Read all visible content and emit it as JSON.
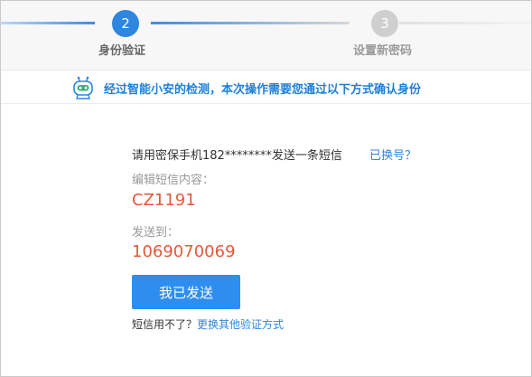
{
  "steps": {
    "active": {
      "number": "2",
      "label": "身份验证"
    },
    "next": {
      "number": "3",
      "label": "设置新密码"
    }
  },
  "notice": {
    "icon": "robot-assistant-icon",
    "text": "经过智能小安的检测，本次操作需要您通过以下方式确认身份"
  },
  "verification": {
    "instruction": "请用密保手机182********发送一条短信",
    "change_number_link": "已换号？",
    "sms_content_label": "编辑短信内容：",
    "sms_content_value": "CZ1191",
    "send_to_label": "发送到：",
    "send_to_value": "1069070069",
    "sent_button": "我已发送",
    "footer_question": "短信用不了？",
    "footer_link": "更换其他验证方式"
  },
  "colors": {
    "accent": "#2e86de",
    "highlight_red": "#e4593a",
    "notice_blue": "#1e7fd8"
  }
}
